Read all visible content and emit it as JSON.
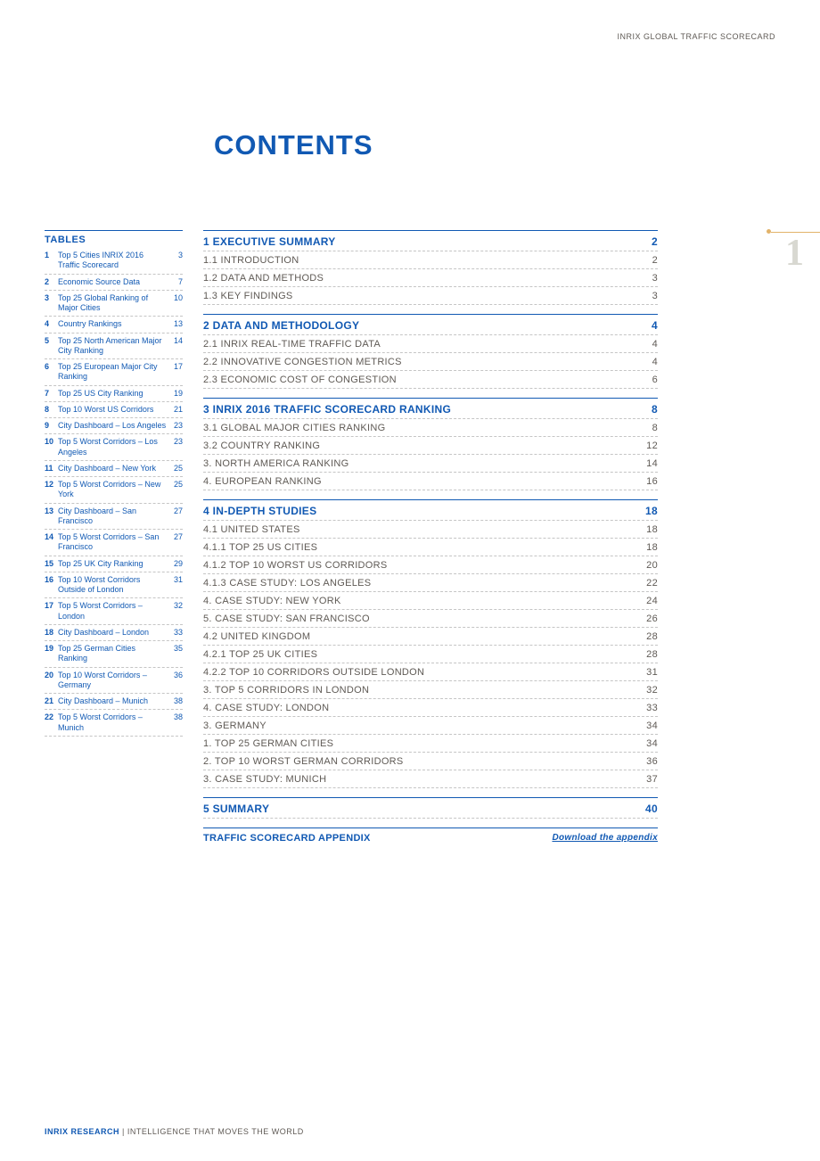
{
  "header": "INRIX GLOBAL TRAFFIC SCORECARD",
  "pageNumber": "1",
  "title": "CONTENTS",
  "tablesTitle": "TABLES",
  "tables": [
    {
      "n": "1",
      "t": "Top 5 Cities INRIX 2016 Traffic Scorecard",
      "p": "3"
    },
    {
      "n": "2",
      "t": "Economic Source Data",
      "p": "7"
    },
    {
      "n": "3",
      "t": "Top 25 Global Ranking of Major Cities",
      "p": "10"
    },
    {
      "n": "4",
      "t": "Country Rankings",
      "p": "13"
    },
    {
      "n": "5",
      "t": "Top 25 North American Major City Ranking",
      "p": "14"
    },
    {
      "n": "6",
      "t": "Top 25 European Major City Ranking",
      "p": "17"
    },
    {
      "n": "7",
      "t": "Top 25 US City Ranking",
      "p": "19"
    },
    {
      "n": "8",
      "t": "Top 10 Worst US Corridors",
      "p": "21"
    },
    {
      "n": "9",
      "t": "City Dashboard – Los Angeles",
      "p": "23"
    },
    {
      "n": "10",
      "t": "Top 5 Worst Corridors – Los Angeles",
      "p": "23"
    },
    {
      "n": "11",
      "t": "City Dashboard – New York",
      "p": "25"
    },
    {
      "n": "12",
      "t": "Top 5 Worst Corridors – New York",
      "p": "25"
    },
    {
      "n": "13",
      "t": "City Dashboard – San Francisco",
      "p": "27"
    },
    {
      "n": "14",
      "t": "Top 5 Worst Corridors – San Francisco",
      "p": "27"
    },
    {
      "n": "15",
      "t": "Top 25 UK City Ranking",
      "p": "29"
    },
    {
      "n": "16",
      "t": "Top 10 Worst Corridors Outside of London",
      "p": "31"
    },
    {
      "n": "17",
      "t": "Top 5 Worst Corridors – London",
      "p": "32"
    },
    {
      "n": "18",
      "t": "City Dashboard – London",
      "p": "33"
    },
    {
      "n": "19",
      "t": "Top 25 German Cities Ranking",
      "p": "35"
    },
    {
      "n": "20",
      "t": "Top 10 Worst Corridors – Germany",
      "p": "36"
    },
    {
      "n": "21",
      "t": "City Dashboard – Munich",
      "p": "38"
    },
    {
      "n": "22",
      "t": "Top 5 Worst Corridors – Munich",
      "p": "38"
    }
  ],
  "toc": [
    {
      "label": "1 EXECUTIVE SUMMARY",
      "pg": "2",
      "head": true,
      "first": true
    },
    {
      "label": "1.1 INTRODUCTION",
      "pg": "2"
    },
    {
      "label": "1.2 DATA AND METHODS",
      "pg": "3"
    },
    {
      "label": "1.3 KEY FINDINGS",
      "pg": "3"
    },
    {
      "label": "2 DATA AND METHODOLOGY",
      "pg": "4",
      "head": true
    },
    {
      "label": "2.1 INRIX REAL-TIME TRAFFIC DATA",
      "pg": "4"
    },
    {
      "label": "2.2 INNOVATIVE CONGESTION METRICS",
      "pg": "4"
    },
    {
      "label": "2.3 ECONOMIC COST OF CONGESTION",
      "pg": "6"
    },
    {
      "label": "3 INRIX 2016 TRAFFIC SCORECARD RANKING",
      "pg": "8",
      "head": true
    },
    {
      "label": "3.1 GLOBAL MAJOR CITIES RANKING",
      "pg": "8"
    },
    {
      "label": "3.2 COUNTRY RANKING",
      "pg": "12"
    },
    {
      "label": "3.   NORTH AMERICA RANKING",
      "pg": "14"
    },
    {
      "label": "4.   EUROPEAN RANKING",
      "pg": "16"
    },
    {
      "label": "4 IN-DEPTH STUDIES",
      "pg": "18",
      "head": true
    },
    {
      "label": "4.1 UNITED STATES",
      "pg": "18"
    },
    {
      "label": "4.1.1 TOP 25 US CITIES",
      "pg": "18"
    },
    {
      "label": "4.1.2 TOP 10 WORST US CORRIDORS",
      "pg": "20"
    },
    {
      "label": "4.1.3 CASE STUDY: LOS ANGELES",
      "pg": "22"
    },
    {
      "label": "4.     CASE STUDY: NEW YORK",
      "pg": "24"
    },
    {
      "label": "5.     CASE STUDY: SAN FRANCISCO",
      "pg": "26"
    },
    {
      "label": "4.2 UNITED KINGDOM",
      "pg": "28"
    },
    {
      "label": "4.2.1 TOP 25 UK CITIES",
      "pg": "28"
    },
    {
      "label": "4.2.2 TOP 10 CORRIDORS OUTSIDE LONDON",
      "pg": "31"
    },
    {
      "label": "3.     TOP 5 CORRIDORS IN LONDON",
      "pg": "32"
    },
    {
      "label": "4.     CASE STUDY: LONDON",
      "pg": "33"
    },
    {
      "label": "3.   GERMANY",
      "pg": "34"
    },
    {
      "label": "1.     TOP 25 GERMAN CITIES",
      "pg": "34"
    },
    {
      "label": "2.     TOP 10 WORST GERMAN CORRIDORS",
      "pg": "36"
    },
    {
      "label": "3.     CASE STUDY: MUNICH",
      "pg": "37"
    },
    {
      "label": "5 SUMMARY",
      "pg": "40",
      "head": true
    },
    {
      "label": "TRAFFIC SCORECARD APPENDIX",
      "pg": "Download the appendix",
      "head": true,
      "appendix": true
    }
  ],
  "footer": {
    "brand": "INRIX RESEARCH",
    "rest": " | INTELLIGENCE THAT MOVES THE WORLD"
  }
}
